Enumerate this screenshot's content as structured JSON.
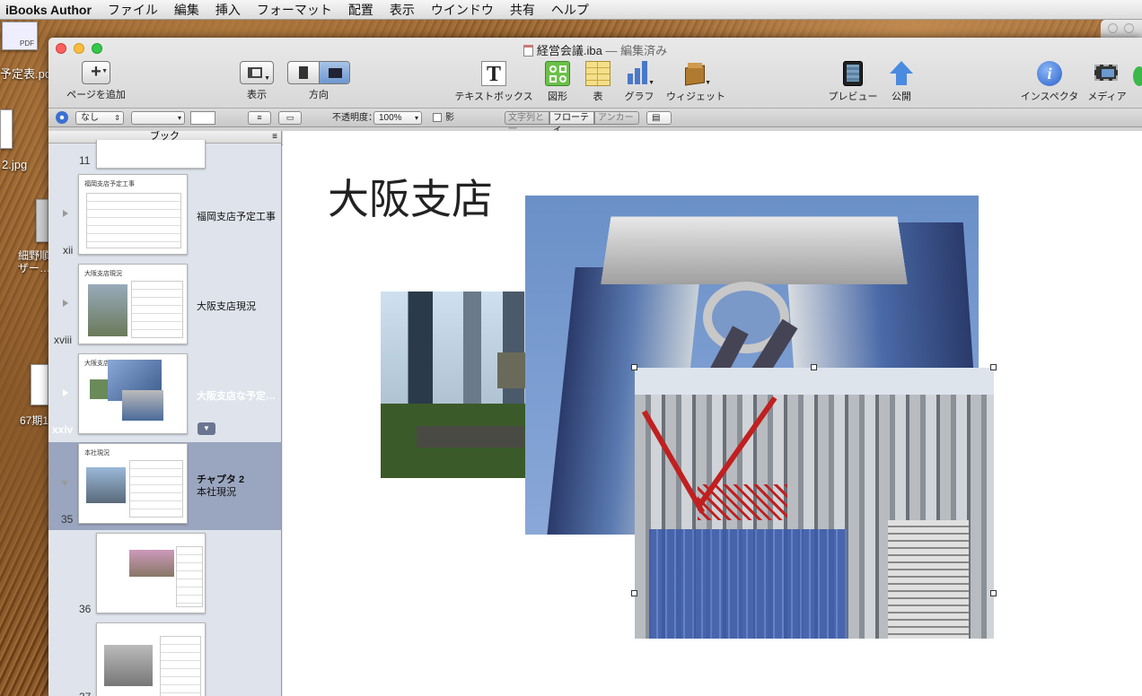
{
  "menubar": {
    "app_name": "iBooks Author",
    "items": [
      "ファイル",
      "編集",
      "挿入",
      "フォーマット",
      "配置",
      "表示",
      "ウインドウ",
      "共有",
      "ヘルプ"
    ]
  },
  "desktop": {
    "icons": [
      {
        "label": "PDF"
      },
      {
        "label": "予定表.pdf"
      },
      {
        "label": "2.jpg"
      },
      {
        "label": "細野順\nザー…"
      },
      {
        "label": "67期1"
      }
    ]
  },
  "window": {
    "title": "経営会議.iba",
    "edited": " — 編集済み"
  },
  "toolbar": {
    "add_page": "ページを追加",
    "view": "表示",
    "orientation": "方向",
    "textbox": "テキストボックス",
    "shape": "図形",
    "table": "表",
    "chart": "グラフ",
    "widget": "ウィジェット",
    "preview": "プレビュー",
    "publish": "公開",
    "inspector": "インスペクタ",
    "media": "メディア"
  },
  "formatbar": {
    "fill_select": "なし",
    "opacity_label": "不透明度：",
    "opacity_value": "100%",
    "shadow_label": "影",
    "wrap_inline": "文字列と一",
    "wrap_floating": "フローティ",
    "wrap_anchor": "アンカー"
  },
  "sidebar": {
    "header": "ブック",
    "rows": [
      {
        "page": "11",
        "label": ""
      },
      {
        "page": "xii",
        "label": "福岡支店予定工事",
        "thumb_title": "福岡支店予定工事"
      },
      {
        "page": "xviii",
        "label": "大阪支店現況",
        "thumb_title": "大阪支店現況"
      },
      {
        "page": "xxiv",
        "label": "大阪支店な予定…",
        "thumb_title": "大阪支店"
      },
      {
        "page": "35",
        "label": "チャプタ 2",
        "sublabel": "本社現況",
        "thumb_title": "本社現況"
      },
      {
        "page": "36",
        "label": ""
      },
      {
        "page": "37",
        "label": ""
      }
    ]
  },
  "canvas": {
    "heading": "大阪支店"
  },
  "colors": {
    "selection": "#9aa6bf",
    "sidebar_bg": "#dfe4ec",
    "close": "#fc605c",
    "minimize": "#fdbc40",
    "zoom": "#34c84a"
  }
}
